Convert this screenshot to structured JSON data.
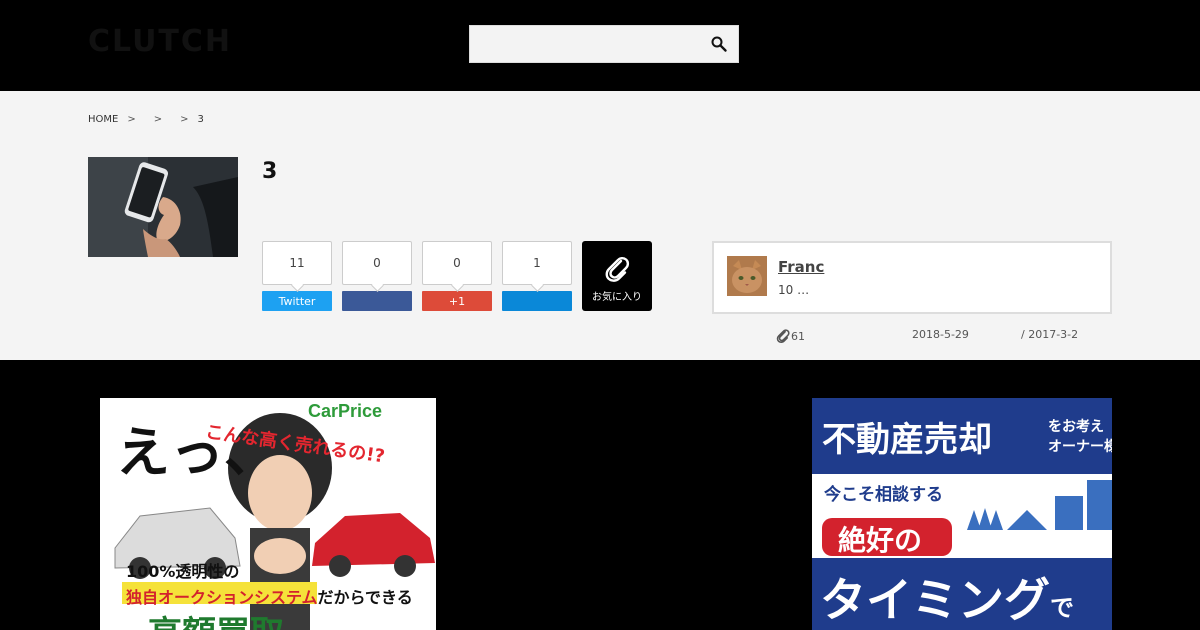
{
  "header": {
    "logo": "CLUTCH",
    "search": {
      "placeholder": "",
      "value": ""
    }
  },
  "breadcrumb": {
    "home": "HOME",
    "separators": [
      ">",
      ">",
      ">"
    ],
    "current": "3"
  },
  "article": {
    "title": "3",
    "share": [
      {
        "count": "11",
        "label": "Twitter",
        "color": "#1da1f2"
      },
      {
        "count": "0",
        "label": "",
        "color": "#3b5998"
      },
      {
        "count": "0",
        "label": "+1",
        "color": "#dd4b39"
      },
      {
        "count": "1",
        "label": "",
        "color": "#0a88d8"
      }
    ],
    "favorite_label": "お気に入り",
    "author": {
      "name": "Franc",
      "desc": "10 …"
    },
    "meta": {
      "clips": "61",
      "updated": "2018-5-29",
      "published": "/ 2017-3-2"
    }
  },
  "ads": {
    "ad1": {
      "brand": "CarPrice",
      "headline": "えっ、",
      "sub": "こんな高く売れるの!?",
      "line1": "100%透明性の",
      "line2_highlight": "独自オークションシステム",
      "line2_rest": "だからできる",
      "line3": "高額買取"
    },
    "ad2": {
      "title": "不動産売却",
      "title_suffix": "をお考え",
      "title_suffix2": "オーナー様",
      "consult": "今こそ相談する",
      "good": "絶好の",
      "timing": "タイミング",
      "timing_suffix": "で"
    }
  }
}
